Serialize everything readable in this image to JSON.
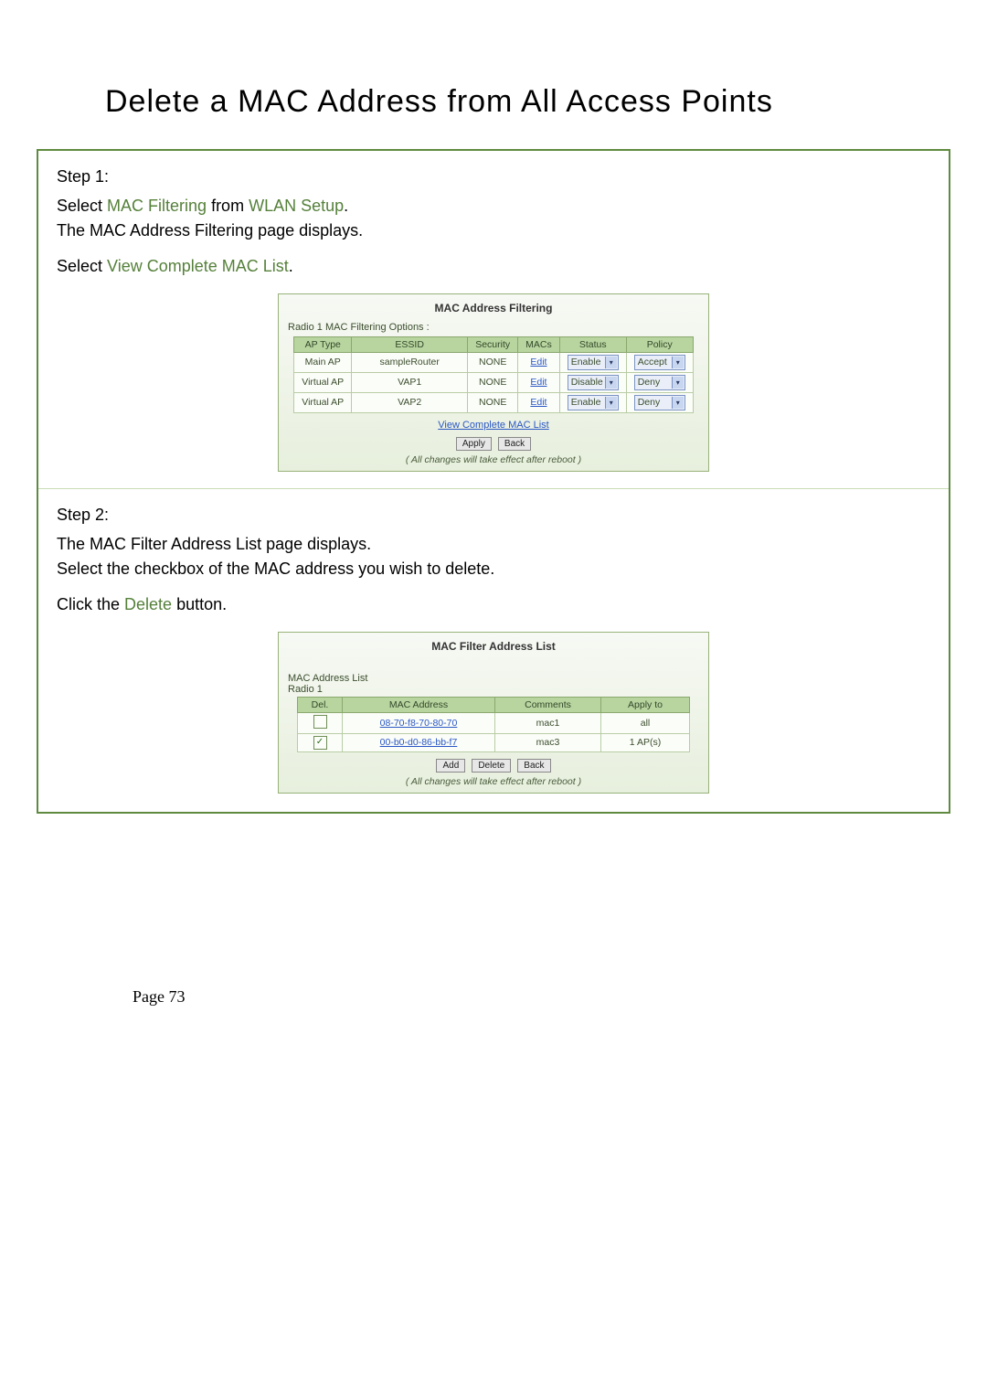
{
  "title": "Delete a MAC Address from All Access Points",
  "step1": {
    "label": "Step 1:",
    "sel": "Select ",
    "link1": "MAC Filtering",
    "from": " from ",
    "link2": "WLAN Setup",
    "period": ".",
    "line2": "The MAC Address Filtering page displays.",
    "sel2": "Select ",
    "link3": "View Complete MAC List",
    "period2": "."
  },
  "panel1": {
    "title": "MAC Address Filtering",
    "subhead": "Radio 1 MAC Filtering Options :",
    "headers": [
      "AP Type",
      "ESSID",
      "Security",
      "MACs",
      "Status",
      "Policy"
    ],
    "rows": [
      {
        "ap": "Main AP",
        "essid": "sampleRouter",
        "sec": "NONE",
        "macs": "Edit",
        "status": "Enable",
        "policy": "Accept"
      },
      {
        "ap": "Virtual AP",
        "essid": "VAP1",
        "sec": "NONE",
        "macs": "Edit",
        "status": "Disable",
        "policy": "Deny"
      },
      {
        "ap": "Virtual AP",
        "essid": "VAP2",
        "sec": "NONE",
        "macs": "Edit",
        "status": "Enable",
        "policy": "Deny"
      }
    ],
    "view_link": "View Complete MAC List",
    "apply": "Apply",
    "back": "Back",
    "note": "( All changes will take effect after reboot )"
  },
  "step2": {
    "label": "Step 2:",
    "line1": "The MAC Filter Address List page displays.",
    "line2": "Select the checkbox of the MAC address you wish to delete.",
    "click": "Click the ",
    "btn": "Delete",
    "after": " button."
  },
  "panel2": {
    "title": "MAC Filter Address List",
    "sub1": "MAC Address List",
    "sub2": "Radio 1",
    "headers": [
      "Del.",
      "MAC Address",
      "Comments",
      "Apply to"
    ],
    "rows": [
      {
        "checked": false,
        "mac": "08-70-f8-70-80-70",
        "comments": "mac1",
        "apply": "all"
      },
      {
        "checked": true,
        "mac": "00-b0-d0-86-bb-f7",
        "comments": "mac3",
        "apply": "1 AP(s)"
      }
    ],
    "add": "Add",
    "del": "Delete",
    "back": "Back",
    "note": "( All changes will take effect after reboot )"
  },
  "page_num": "Page 73"
}
